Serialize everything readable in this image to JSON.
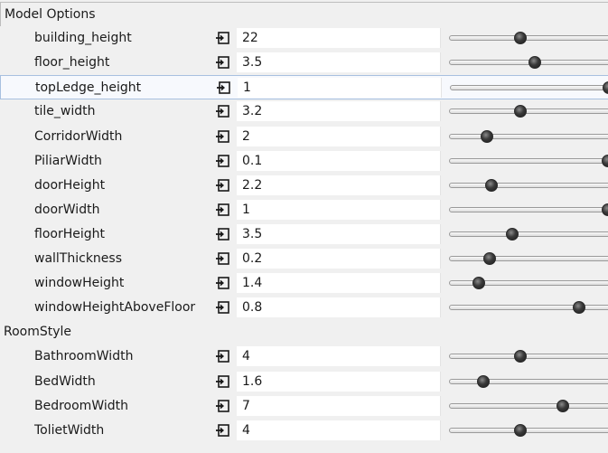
{
  "sections": [
    {
      "title": "Model Options",
      "slider_max": 24,
      "params": [
        {
          "name": "building_height",
          "value": "22"
        },
        {
          "name": "floor_height",
          "value": "3.5"
        },
        {
          "name": "topLedge_height",
          "value": "1"
        },
        {
          "name": "tile_width",
          "value": "3.2"
        },
        {
          "name": "CorridorWidth",
          "value": "2"
        },
        {
          "name": "PiliarWidth",
          "value": "0.1"
        },
        {
          "name": "doorHeight",
          "value": "2.2"
        },
        {
          "name": "doorWidth",
          "value": "1"
        },
        {
          "name": "floorHeight",
          "value": "3.5"
        },
        {
          "name": "wallThickness",
          "value": "0.2"
        },
        {
          "name": "windowHeight",
          "value": "1.4"
        },
        {
          "name": "windowHeightAboveFloor",
          "value": "0.8"
        }
      ]
    },
    {
      "title": "RoomStyle",
      "params": [
        {
          "name": "BathroomWidth",
          "value": "4"
        },
        {
          "name": "BedWidth",
          "value": "1.6"
        },
        {
          "name": "BedroomWidth",
          "value": "7"
        },
        {
          "name": "ToiletWidth",
          "value": "4"
        }
      ]
    }
  ],
  "slider_levels": [
    0.42,
    0.52,
    1.0,
    0.42,
    0.2,
    1.0,
    0.23,
    1.0,
    0.37,
    0.22,
    0.15,
    0.81,
    0.42,
    0.18,
    0.7,
    0.42
  ],
  "highlighted_param": "topLedge_height",
  "colors": {
    "background": "#f0f0f0",
    "value_box": "#ffffff",
    "highlight_border": "#a8c0e0",
    "slider_thumb": "#2a2a2a",
    "link_icon": "#1a1a1a"
  },
  "icons": {
    "link": "link-parameter-icon",
    "slider": "slider-thumb"
  }
}
